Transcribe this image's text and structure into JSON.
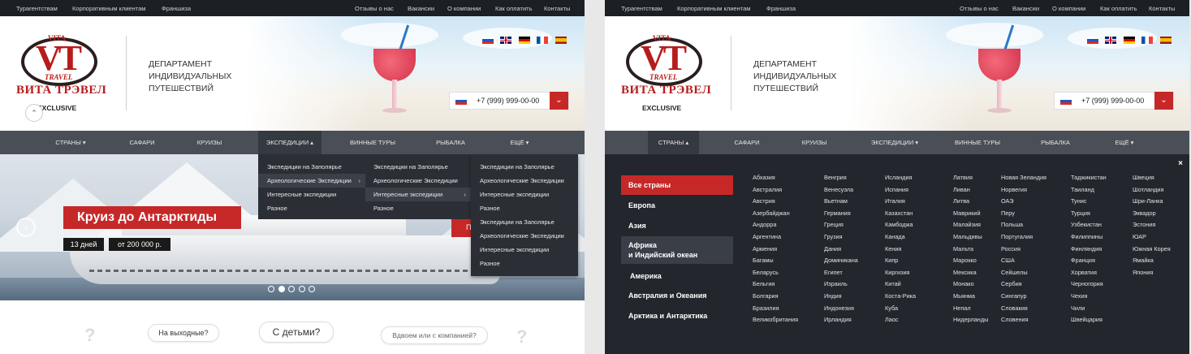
{
  "topbar": {
    "left": [
      "Турагентствам",
      "Корпоративным клиентам",
      "Франшиза"
    ],
    "right": [
      "Отзывы о нас",
      "Вакансии",
      "О компании",
      "Как оплатить",
      "Контакты"
    ]
  },
  "logo": {
    "vita": "VITA",
    "travel": "TRAVEL",
    "name": "ВИТА ТРЭВЕЛ",
    "exclusive": "EXCLUSIVE"
  },
  "department": "ДЕПАРТАМЕНТ ИНДИВИДУАЛЬНЫХ ПУТЕШЕСТВИЙ",
  "flags": [
    {
      "name": "russia-flag",
      "colors": [
        "#ffffff",
        "#1c57c3",
        "#d52b1e"
      ]
    },
    {
      "name": "uk-flag",
      "colors": [
        "#012169",
        "#ffffff",
        "#c8102e"
      ]
    },
    {
      "name": "germany-flag",
      "colors": [
        "#000000",
        "#dd0000",
        "#ffce00"
      ]
    },
    {
      "name": "france-flag",
      "colors": [
        "#0055a4",
        "#ffffff",
        "#ef4135"
      ]
    },
    {
      "name": "spain-flag",
      "colors": [
        "#aa151b",
        "#f1bf00",
        "#aa151b"
      ]
    }
  ],
  "phone": "+7 (999) 999-00-00",
  "nav": {
    "left": [
      "СТРАНЫ ▾",
      "САФАРИ",
      "КРУИЗЫ",
      "ЭКСПЕДИЦИИ ▴",
      "ВИННЫЕ ТУРЫ",
      "РЫБАЛКА",
      "ЕЩЁ ▾"
    ],
    "right": [
      "СТРАНЫ ▴",
      "САФАРИ",
      "КРУИЗЫ",
      "ЭКСПЕДИЦИИ ▾",
      "ВИННЫЕ ТУРЫ",
      "РЫБАЛКА",
      "ЕЩЁ ▾"
    ]
  },
  "dropdown": {
    "level1": [
      "Экспедиции на Заполярье",
      "Археологические Экспедиции",
      "Интересные экспедиции",
      "Разное"
    ],
    "level2": [
      "Экспедиции на Заполярье",
      "Археологические Экспедиции",
      "Интересные экспедиции",
      "Разное"
    ],
    "level3": [
      "Экспедиции на Заполярье",
      "Археологические Экспедиции",
      "Интересные экспедиции",
      "Разное",
      "Экспедиции на Заполярье",
      "Археологические Экспедиции",
      "Интересные экспедиции",
      "Разное"
    ]
  },
  "slider": {
    "title": "Круиз до Антарктиды",
    "days": "13 дней",
    "price": "от 200 000 р.",
    "prev_arrow": "‹",
    "cut_label": "П",
    "slides_total": 5,
    "slide_active": 2
  },
  "bubbles": [
    "На выходные?",
    "С детьми?",
    "Вдвоем или с компанией?"
  ],
  "mega": {
    "close": "×",
    "categories": [
      "Все страны",
      "Европа",
      "Азия",
      "Африка",
      "и Индийский океан",
      "Америка",
      "Австралия и Океания",
      "Арктика и Антарктика"
    ],
    "columns": [
      [
        "Абхазия",
        "Австралия",
        "Австрия",
        "Азербайджан",
        "Андорра",
        "Аргентина",
        "Армения",
        "Багамы",
        "Беларусь",
        "Бельгия",
        "Болгария",
        "Бразилия",
        "Великобритания"
      ],
      [
        "Венгрия",
        "Венесуэла",
        "Вьетнам",
        "Германия",
        "Греция",
        "Грузия",
        "Дания",
        "Доминикана",
        "Египет",
        "Израиль",
        "Индия",
        "Индонезия",
        "Ирландия"
      ],
      [
        "Исландия",
        "Испания",
        "Италия",
        "Казахстан",
        "Камбоджа",
        "Канада",
        "Кения",
        "Кипр",
        "Киргизия",
        "Китай",
        "Коста-Рика",
        "Куба",
        "Лаос"
      ],
      [
        "Латвия",
        "Ливан",
        "Литва",
        "Маврикий",
        "Малайзия",
        "Мальдивы",
        "Мальта",
        "Марокко",
        "Мексика",
        "Монако",
        "Мьянма",
        "Непал",
        "Нидерланды"
      ],
      [
        "Новая Зеландия",
        "Норвегия",
        "ОАЭ",
        "Перу",
        "Польша",
        "Португалия",
        "Россия",
        "США",
        "Сейшелы",
        "Сербия",
        "Сингапур",
        "Словакия",
        "Словения"
      ],
      [
        "Таджикистан",
        "Таиланд",
        "Тунис",
        "Турция",
        "Узбекистан",
        "Филиппины",
        "Финляндия",
        "Франция",
        "Хорватия",
        "Черногория",
        "Чехия",
        "Чили",
        "Швейцария"
      ],
      [
        "Швеция",
        "Шотландия",
        "Шри-Ланка",
        "Эквадор",
        "Эстония",
        "ЮАР",
        "Южная Корея",
        "Ямайка",
        "Япония"
      ]
    ]
  },
  "colors": {
    "accent": "#c62828",
    "nav": "#4a4f57",
    "topbar": "#1c1f24",
    "menu": "#23272d"
  }
}
